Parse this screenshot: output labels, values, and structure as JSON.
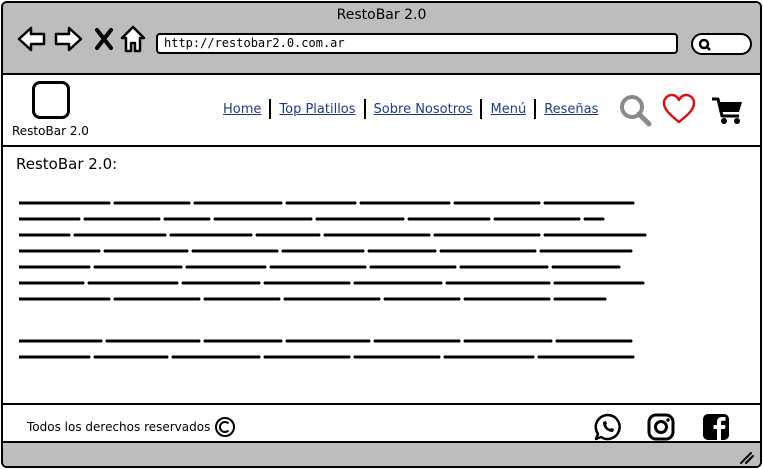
{
  "browser": {
    "title": "RestoBar 2.0",
    "url": "http://restobar2.0.com.ar",
    "icons": [
      "back-arrow-icon",
      "forward-arrow-icon",
      "close-icon",
      "home-icon",
      "search-icon"
    ]
  },
  "site": {
    "logo_text": "RestoBar 2.0",
    "nav": [
      {
        "label": "Home"
      },
      {
        "label": "Top Platillos"
      },
      {
        "label": "Sobre Nosotros"
      },
      {
        "label": "Menú"
      },
      {
        "label": "Reseñas"
      }
    ],
    "header_icons": [
      "search-icon",
      "heart-icon",
      "cart-icon"
    ],
    "link_color": "#1f3a8a"
  },
  "content": {
    "heading": "RestoBar 2.0:"
  },
  "footer": {
    "copyright_text": "Todos los derechos reservados",
    "social_icons": [
      "whatsapp-icon",
      "instagram-icon",
      "facebook-icon"
    ]
  }
}
